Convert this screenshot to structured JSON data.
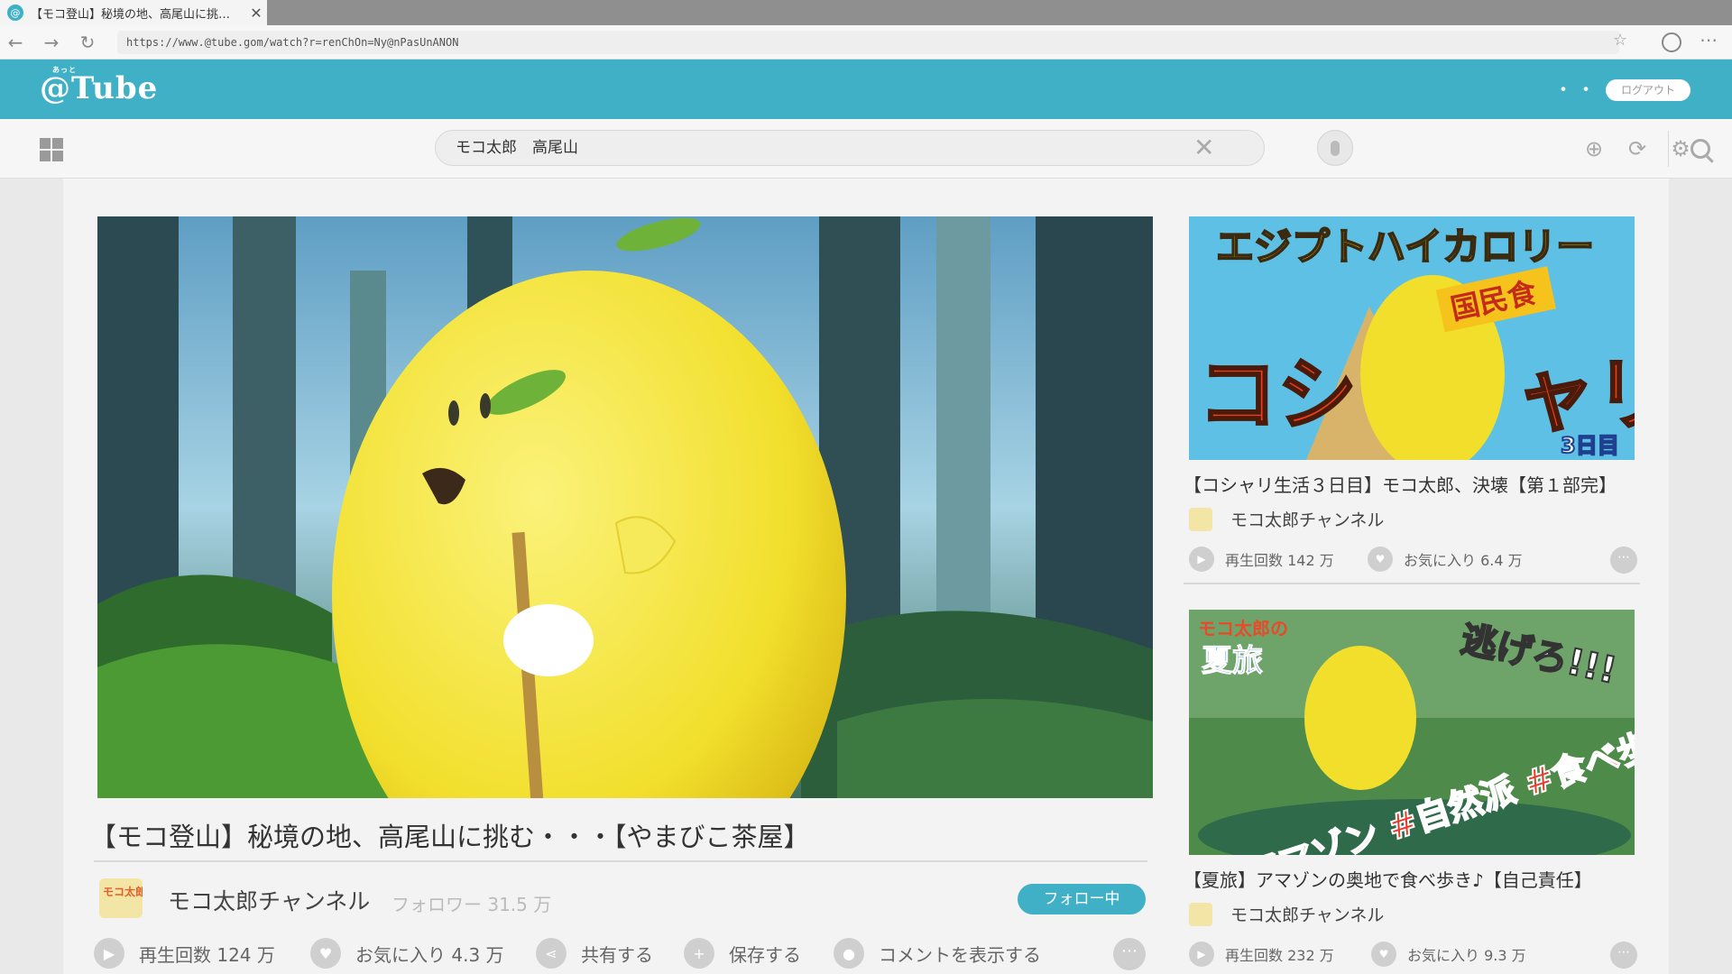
{
  "browser": {
    "tab_title": "【モコ登山】秘境の地、高尾山に挑…",
    "favicon": "@",
    "url": "https://www.@tube.gom/watch?r=renChOn=Ny@nPasUnANON"
  },
  "site": {
    "logo": "@Tube",
    "logo_ruby": "あっと",
    "more": "・・・",
    "logout_label": "ログアウト",
    "accent_color": "#3fb0c6"
  },
  "search": {
    "query": "モコ太郎　高尾山"
  },
  "main_video": {
    "title": "【モコ登山】秘境の地、高尾山に挑む・・・【やまびこ茶屋】",
    "channel_name": "モコ太郎チャンネル",
    "avatar_text": "モコ太郎",
    "followers": "フォロワー 31.5 万",
    "follow_label": "フォロー中",
    "actions": {
      "views": "再生回数 124 万",
      "likes": "お気に入り 4.3 万",
      "share": "共有する",
      "save": "保存する",
      "comments": "コメントを表示する"
    }
  },
  "related": [
    {
      "thumb_top": "エジプトハイカロリー",
      "thumb_badge": "国民食",
      "thumb_big": "コシ　　ャリ",
      "thumb_day": "3日目",
      "title": "【コシャリ生活３日目】モコ太郎、決壊【第１部完】",
      "channel": "モコ太郎チャンネル",
      "views": "再生回数 142 万",
      "likes": "お気に入り 6.4 万"
    },
    {
      "thumb_brand": "モコ太郎の",
      "thumb_series": "夏旅",
      "thumb_shout": "逃げろ!!!",
      "thumb_tags": "#アマゾン #自然派 #食べ歩き",
      "title": "【夏旅】アマゾンの奥地で食べ歩き♪【自己責任】",
      "channel": "モコ太郎チャンネル",
      "views": "再生回数 232 万",
      "likes": "お気に入り 9.3 万"
    }
  ]
}
